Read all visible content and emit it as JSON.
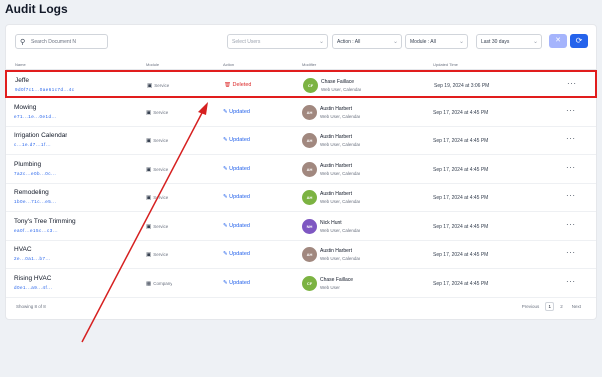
{
  "page": {
    "title": "Audit Logs"
  },
  "toolbar": {
    "search_placeholder": "Search Document N",
    "users_placeholder": "Select Users",
    "action_filter": "Action : All",
    "module_filter": "Module : All",
    "date_filter": "Last 30 days"
  },
  "table": {
    "headers": [
      "Name",
      "Module",
      "Action",
      "Modifier",
      "Updated Time"
    ],
    "rows": [
      {
        "name": "Jeffe",
        "link": "9d0f7c1...0ae61c7d...4c",
        "module": "Service",
        "action": "Deleted",
        "action_type": "deleted",
        "user": "Chase Faillace",
        "role": "Web User, Calendar",
        "avatar_initials": "CF",
        "avatar_color": "#7cb342",
        "date": "Sep 19, 2024 at 3:06 PM"
      },
      {
        "name": "Mowing",
        "link": "e71...1e...0e1d...",
        "module": "Service",
        "action": "Updated",
        "action_type": "updated",
        "user": "Austin Harbert",
        "role": "Web User, Calendar",
        "avatar_initials": "AH",
        "avatar_color": "#a1887f",
        "date": "Sep 17, 2024 at 4:45 PM"
      },
      {
        "name": "Irrigation Calendar",
        "link": "c...1e.d7...1f...",
        "module": "Service",
        "action": "Updated",
        "action_type": "updated",
        "user": "Austin Harbert",
        "role": "Web User, Calendar",
        "avatar_initials": "AH",
        "avatar_color": "#a1887f",
        "date": "Sep 17, 2024 at 4:45 PM"
      },
      {
        "name": "Plumbing",
        "link": "7a2c...e0b...0c...",
        "module": "Service",
        "action": "Updated",
        "action_type": "updated",
        "user": "Austin Harbert",
        "role": "Web User, Calendar",
        "avatar_initials": "AH",
        "avatar_color": "#a1887f",
        "date": "Sep 17, 2024 at 4:45 PM"
      },
      {
        "name": "Remodeling",
        "link": "1b0e...71c...e5...",
        "module": "Service",
        "action": "Updated",
        "action_type": "updated",
        "user": "Austin Harbert",
        "role": "Web User, Calendar",
        "avatar_initials": "AH",
        "avatar_color": "#7cb342",
        "date": "Sep 17, 2024 at 4:45 PM"
      },
      {
        "name": "Tony's Tree Trimming",
        "link": "ea0f...e15c...c3...",
        "module": "Service",
        "action": "Updated",
        "action_type": "updated",
        "user": "Nick Hunt",
        "role": "Web User, Calendar",
        "avatar_initials": "NH",
        "avatar_color": "#7e57c2",
        "date": "Sep 17, 2024 at 4:45 PM"
      },
      {
        "name": "HVAC",
        "link": "2e...0a1...b7...",
        "module": "Service",
        "action": "Updated",
        "action_type": "updated",
        "user": "Austin Harbert",
        "role": "Web User, Calendar",
        "avatar_initials": "AH",
        "avatar_color": "#a1887f",
        "date": "Sep 17, 2024 at 4:45 PM"
      },
      {
        "name": "Rising HVAC",
        "link": "d0e1...a9...4f...",
        "module": "Company",
        "action": "Updated",
        "action_type": "updated",
        "user": "Chase Faillace",
        "role": "Web User",
        "avatar_initials": "CF",
        "avatar_color": "#7cb342",
        "date": "Sep 17, 2024 at 4:45 PM"
      }
    ]
  },
  "footer": {
    "summary": "Showing 8 of 8",
    "previous": "Previous",
    "pages": [
      "1",
      "2"
    ],
    "next": "Next"
  },
  "colors": {
    "highlight": "#e11d1d",
    "annotation_arrow": "#d62020",
    "primary": "#2563eb",
    "deleted": "#dc2626"
  }
}
